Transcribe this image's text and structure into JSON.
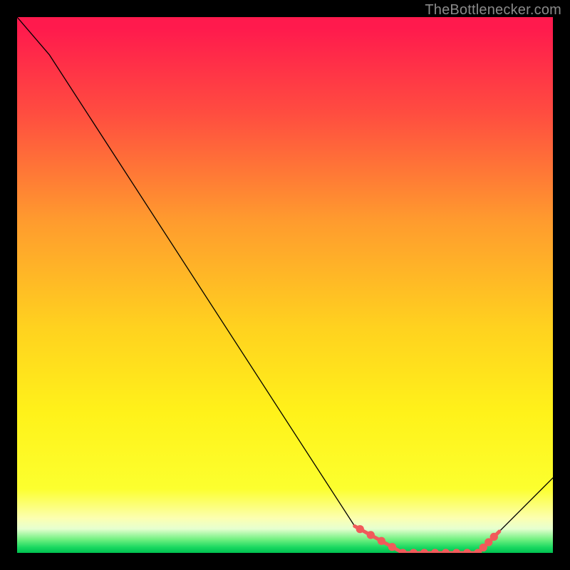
{
  "attribution": "TheBottlenecker.com",
  "chart_data": {
    "type": "line",
    "title": "",
    "xlabel": "",
    "ylabel": "",
    "xlim": [
      0,
      100
    ],
    "ylim": [
      0,
      100
    ],
    "x": [
      0,
      6,
      63,
      72,
      86,
      100
    ],
    "series": [
      {
        "name": "curve",
        "values": [
          100,
          93,
          5,
          0,
          0,
          14
        ]
      }
    ],
    "highlight": {
      "x_range": [
        63,
        90
      ],
      "color": "#f15a5a",
      "points_x": [
        64,
        66,
        68,
        70,
        72,
        74,
        76,
        78,
        80,
        82,
        84,
        86,
        87,
        88,
        89
      ]
    },
    "background_gradient": {
      "stops": [
        {
          "offset": 0.0,
          "color": "#ff1a4d"
        },
        {
          "offset": 0.02,
          "color": "#ff1a4d"
        },
        {
          "offset": 0.18,
          "color": "#ff4d40"
        },
        {
          "offset": 0.38,
          "color": "#ff9b2e"
        },
        {
          "offset": 0.58,
          "color": "#ffd21f"
        },
        {
          "offset": 0.74,
          "color": "#fff21a"
        },
        {
          "offset": 0.88,
          "color": "#fcff2e"
        },
        {
          "offset": 0.935,
          "color": "#fcffb0"
        },
        {
          "offset": 0.955,
          "color": "#e6ffd0"
        },
        {
          "offset": 0.975,
          "color": "#70f080"
        },
        {
          "offset": 0.99,
          "color": "#18d860"
        },
        {
          "offset": 1.0,
          "color": "#00c050"
        }
      ]
    }
  },
  "plot": {
    "vx": 0,
    "vy": 0,
    "vw": 100,
    "vh": 100
  }
}
